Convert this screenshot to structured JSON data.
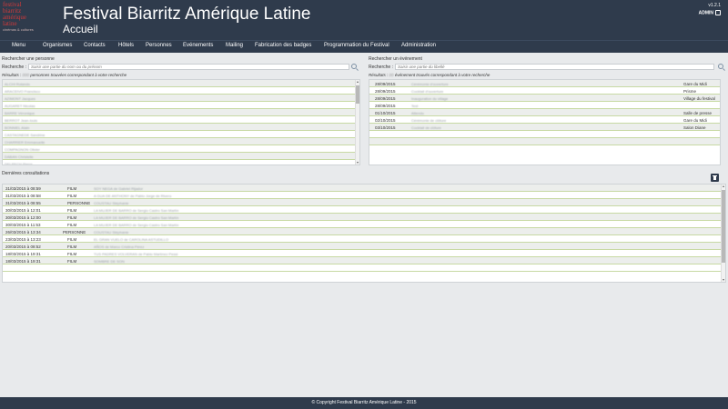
{
  "header": {
    "logo_lines": [
      "festival",
      "biarritz",
      "amérique",
      "latine"
    ],
    "logo_tagline": "cinémas & cultures",
    "title": "Festival Biarritz Amérique Latine",
    "subtitle": "Accueil",
    "version": "v1.2.1",
    "user": "ADMIN"
  },
  "nav": [
    "Menu",
    "Organismes",
    "Contacts",
    "Hôtels",
    "Personnes",
    "Evénements",
    "Mailing",
    "Fabrication des badges",
    "Programmation du Festival",
    "Administration"
  ],
  "person_search": {
    "section_title": "Rechercher une personne",
    "label": "Recherche :",
    "placeholder": "Saisir une partie du nom ou du prénom",
    "results_prefix": "Résultats :",
    "results_suffix": "personnes trouvées correspondant à votre recherche"
  },
  "event_search": {
    "section_title": "Rechercher un événement",
    "label": "Recherche :",
    "placeholder": "Saisir une partie du libellé",
    "results_prefix": "Résultats :",
    "results_suffix": "événement trouvés correspondant à votre recherche",
    "rows": [
      {
        "date": "28/09/2015",
        "place": "Gare du Midi"
      },
      {
        "date": "28/09/2015",
        "place": "Prisme"
      },
      {
        "date": "28/09/2015",
        "place": "Village du festival"
      },
      {
        "date": "28/09/2015",
        "place": ""
      },
      {
        "date": "01/10/2015",
        "place": "Salle de presse"
      },
      {
        "date": "02/10/2015",
        "place": "Gare du Midi"
      },
      {
        "date": "03/10/2015",
        "place": "Salon Diane"
      },
      {
        "date": "",
        "place": ""
      },
      {
        "date": "",
        "place": ""
      }
    ]
  },
  "recent": {
    "section_title": "Dernières consultations",
    "rows": [
      {
        "date": "31/03/2015 à 08:59",
        "type": "FILM"
      },
      {
        "date": "31/03/2015 à 08:58",
        "type": "FILM"
      },
      {
        "date": "31/03/2015 à 08:55",
        "type": "PERSONNE"
      },
      {
        "date": "30/03/2015 à 12:01",
        "type": "FILM"
      },
      {
        "date": "30/03/2015 à 12:00",
        "type": "FILM"
      },
      {
        "date": "30/03/2015 à 11:53",
        "type": "FILM"
      },
      {
        "date": "26/03/2015 à 13:34",
        "type": "PERSONNE"
      },
      {
        "date": "23/03/2015 à 13:23",
        "type": "FILM"
      },
      {
        "date": "20/03/2015 à 08:52",
        "type": "FILM"
      },
      {
        "date": "18/03/2015 à 19:31",
        "type": "FILM"
      },
      {
        "date": "18/03/2015 à 19:31",
        "type": "FILM"
      },
      {
        "date": "",
        "type": ""
      }
    ]
  },
  "footer": "© Copyright Festival Biarritz Amérique Latine - 2015"
}
